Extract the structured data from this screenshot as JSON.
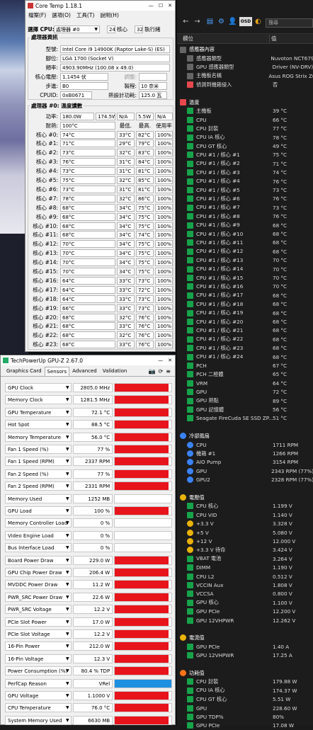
{
  "coretemp": {
    "title": "Core Temp 1.18.1",
    "menu": [
      "檔案(F)",
      "選項(O)",
      "工具(T)",
      "說明(H)"
    ],
    "select_label": "選擇 CPU:",
    "select_value": "處理器 #0",
    "cores": "24",
    "cores_label": "核心",
    "threads": "32",
    "threads_label": "執行緒",
    "info_title": "處理器資訊",
    "model_label": "型號:",
    "model": "Intel Core i9 14900K (Raptor Lake-S)  (ES)",
    "socket_label": "腳位:",
    "socket": "LGA 1700 (Socket V)",
    "freq_label": "頻率:",
    "freq": "4903.90MHz (100.08 x 49.0)",
    "volt_label": "核心電壓:",
    "volt": "1.1454 伏",
    "adj_label": "調整:",
    "step_label": "步進:",
    "step": "B0",
    "proc_label": "製程:",
    "proc": "10 奈米",
    "cpuid_label": "CPUID:",
    "cpuid": "0xB0671",
    "tdp_label": "熱設計功耗:",
    "tdp": "125.0 瓦",
    "temp_title": "處理器 #0: 溫度讀數",
    "power_label": "功率:",
    "power": [
      "180.0W",
      "174.5W",
      "N/A",
      "5.5W",
      "N/A"
    ],
    "tj_label": "耐熱:",
    "tj": "100°C",
    "col_min": "最低.",
    "col_max": "最高.",
    "col_load": "使用率",
    "cores_rows": [
      [
        "核心 #0:",
        "74°C",
        "33°C",
        "82°C",
        "100%"
      ],
      [
        "核心 #1:",
        "71°C",
        "29°C",
        "79°C",
        "100%"
      ],
      [
        "核心 #2:",
        "73°C",
        "32°C",
        "83°C",
        "100%"
      ],
      [
        "核心 #3:",
        "76°C",
        "31°C",
        "84°C",
        "100%"
      ],
      [
        "核心 #4:",
        "73°C",
        "31°C",
        "81°C",
        "100%"
      ],
      [
        "核心 #5:",
        "75°C",
        "32°C",
        "85°C",
        "100%"
      ],
      [
        "核心 #6:",
        "73°C",
        "31°C",
        "81°C",
        "100%"
      ],
      [
        "核心 #7:",
        "78°C",
        "32°C",
        "86°C",
        "100%"
      ],
      [
        "核心 #8:",
        "68°C",
        "34°C",
        "75°C",
        "100%"
      ],
      [
        "核心 #9:",
        "68°C",
        "34°C",
        "75°C",
        "100%"
      ],
      [
        "核心 #10:",
        "68°C",
        "34°C",
        "75°C",
        "100%"
      ],
      [
        "核心 #11:",
        "68°C",
        "34°C",
        "74°C",
        "100%"
      ],
      [
        "核心 #12:",
        "70°C",
        "34°C",
        "75°C",
        "100%"
      ],
      [
        "核心 #13:",
        "70°C",
        "34°C",
        "75°C",
        "100%"
      ],
      [
        "核心 #14:",
        "70°C",
        "34°C",
        "75°C",
        "100%"
      ],
      [
        "核心 #15:",
        "70°C",
        "34°C",
        "75°C",
        "100%"
      ],
      [
        "核心 #16:",
        "64°C",
        "33°C",
        "73°C",
        "100%"
      ],
      [
        "核心 #17:",
        "64°C",
        "33°C",
        "72°C",
        "100%"
      ],
      [
        "核心 #18:",
        "64°C",
        "33°C",
        "73°C",
        "100%"
      ],
      [
        "核心 #19:",
        "66°C",
        "33°C",
        "73°C",
        "100%"
      ],
      [
        "核心 #20:",
        "68°C",
        "32°C",
        "76°C",
        "100%"
      ],
      [
        "核心 #21:",
        "68°C",
        "33°C",
        "76°C",
        "100%"
      ],
      [
        "核心 #22:",
        "68°C",
        "32°C",
        "76°C",
        "100%"
      ],
      [
        "核心 #23:",
        "68°C",
        "33°C",
        "76°C",
        "100%"
      ]
    ]
  },
  "gpuz": {
    "title": "TechPowerUp GPU-Z 2.67.0",
    "tabs": [
      "Graphics Card",
      "Sensors",
      "Advanced",
      "Validation"
    ],
    "active_tab": 1,
    "sensors": [
      {
        "name": "GPU Clock",
        "value": "2805.0 MHz",
        "fill": 0.95
      },
      {
        "name": "Memory Clock",
        "value": "1281.5 MHz",
        "fill": 0.95
      },
      {
        "name": "GPU Temperature",
        "value": "72.1 °C",
        "fill": 0.95
      },
      {
        "name": "Hot Spot",
        "value": "88.5 °C",
        "fill": 0.95
      },
      {
        "name": "Memory Temperature",
        "value": "56.0 °C",
        "fill": 0.95
      },
      {
        "name": "Fan 1 Speed (%)",
        "value": "77 %",
        "fill": 0.95
      },
      {
        "name": "Fan 1 Speed (RPM)",
        "value": "2337 RPM",
        "fill": 0.95
      },
      {
        "name": "Fan 2 Speed (%)",
        "value": "77 %",
        "fill": 0.95
      },
      {
        "name": "Fan 2 Speed (RPM)",
        "value": "2331 RPM",
        "fill": 0.95
      },
      {
        "name": "Memory Used",
        "value": "1252 MB",
        "fill": 0.0
      },
      {
        "name": "GPU Load",
        "value": "100 %",
        "fill": 0.95
      },
      {
        "name": "Memory Controller Load",
        "value": "0 %",
        "fill": 0.0
      },
      {
        "name": "Video Engine Load",
        "value": "0 %",
        "fill": 0.0
      },
      {
        "name": "Bus Interface Load",
        "value": "0 %",
        "fill": 0.0
      },
      {
        "name": "Board Power Draw",
        "value": "229.0 W",
        "fill": 0.95
      },
      {
        "name": "GPU Chip Power Draw",
        "value": "206.4 W",
        "fill": 0.95
      },
      {
        "name": "MVDDC Power Draw",
        "value": "11.2 W",
        "fill": 0.95
      },
      {
        "name": "PWR_SRC Power Draw",
        "value": "22.6 W",
        "fill": 0.95
      },
      {
        "name": "PWR_SRC Voltage",
        "value": "12.2 V",
        "fill": 0.95
      },
      {
        "name": "PCIe Slot Power",
        "value": "17.0 W",
        "fill": 0.95
      },
      {
        "name": "PCIe Slot Voltage",
        "value": "12.2 V",
        "fill": 0.95
      },
      {
        "name": "16-Pin Power",
        "value": "212.0 W",
        "fill": 0.95
      },
      {
        "name": "16-Pin Voltage",
        "value": "12.3 V",
        "fill": 0.95
      },
      {
        "name": "Power Consumption (%)",
        "value": "80.4 % TDP",
        "fill": 0.95
      },
      {
        "name": "PerfCap Reason",
        "value": "VRel",
        "fill": 1.0,
        "color": "#1e90e0"
      },
      {
        "name": "GPU Voltage",
        "value": "1.1000 V",
        "fill": 0.95
      },
      {
        "name": "CPU Temperature",
        "value": "76.0 °C",
        "fill": 0.95
      },
      {
        "name": "System Memory Used",
        "value": "6630 MB",
        "fill": 0.95
      }
    ]
  },
  "hwinfo": {
    "search_placeholder": "搜尋",
    "col_name": "欄位",
    "col_value": "值",
    "rows": [
      {
        "s": true,
        "i": "iw",
        "n": "感應器內容",
        "v": ""
      },
      {
        "i": "iw",
        "n": "感應器類型",
        "v": "Nuvoton NCT679"
      },
      {
        "i": "iw",
        "n": "GPU 感應器類型",
        "v": "Driver  (NV-DRV)"
      },
      {
        "i": "iw",
        "n": "主機板名稱",
        "v": "Asus ROG Strix Z6"
      },
      {
        "i": "ir",
        "n": "偵測到機箱侵入",
        "v": "否"
      },
      {
        "blank": true
      },
      {
        "s": true,
        "i": "ir",
        "n": "溫度",
        "v": ""
      },
      {
        "i": "ig",
        "n": "主機板",
        "v": "39 °C"
      },
      {
        "i": "ig",
        "n": "CPU",
        "v": "66 °C"
      },
      {
        "i": "ig",
        "n": "CPU 封裝",
        "v": "77 °C"
      },
      {
        "i": "ig",
        "n": "CPU IA 核心",
        "v": "78 °C"
      },
      {
        "i": "ig",
        "n": "CPU GT 核心",
        "v": "49 °C"
      },
      {
        "i": "ig",
        "n": "CPU #1 / 核心 #1",
        "v": "75 °C"
      },
      {
        "i": "ig",
        "n": "CPU #1 / 核心 #2",
        "v": "71 °C"
      },
      {
        "i": "ig",
        "n": "CPU #1 / 核心 #3",
        "v": "74 °C"
      },
      {
        "i": "ig",
        "n": "CPU #1 / 核心 #4",
        "v": "76 °C"
      },
      {
        "i": "ig",
        "n": "CPU #1 / 核心 #5",
        "v": "73 °C"
      },
      {
        "i": "ig",
        "n": "CPU #1 / 核心 #6",
        "v": "76 °C"
      },
      {
        "i": "ig",
        "n": "CPU #1 / 核心 #7",
        "v": "73 °C"
      },
      {
        "i": "ig",
        "n": "CPU #1 / 核心 #8",
        "v": "76 °C"
      },
      {
        "i": "ig",
        "n": "CPU #1 / 核心 #9",
        "v": "68 °C"
      },
      {
        "i": "ig",
        "n": "CPU #1 / 核心 #10",
        "v": "68 °C"
      },
      {
        "i": "ig",
        "n": "CPU #1 / 核心 #11",
        "v": "68 °C"
      },
      {
        "i": "ig",
        "n": "CPU #1 / 核心 #12",
        "v": "68 °C"
      },
      {
        "i": "ig",
        "n": "CPU #1 / 核心 #13",
        "v": "70 °C"
      },
      {
        "i": "ig",
        "n": "CPU #1 / 核心 #14",
        "v": "70 °C"
      },
      {
        "i": "ig",
        "n": "CPU #1 / 核心 #15",
        "v": "70 °C"
      },
      {
        "i": "ig",
        "n": "CPU #1 / 核心 #16",
        "v": "70 °C"
      },
      {
        "i": "ig",
        "n": "CPU #1 / 核心 #17",
        "v": "68 °C"
      },
      {
        "i": "ig",
        "n": "CPU #1 / 核心 #18",
        "v": "68 °C"
      },
      {
        "i": "ig",
        "n": "CPU #1 / 核心 #19",
        "v": "68 °C"
      },
      {
        "i": "ig",
        "n": "CPU #1 / 核心 #20",
        "v": "68 °C"
      },
      {
        "i": "ig",
        "n": "CPU #1 / 核心 #21",
        "v": "68 °C"
      },
      {
        "i": "ig",
        "n": "CPU #1 / 核心 #22",
        "v": "68 °C"
      },
      {
        "i": "ig",
        "n": "CPU #1 / 核心 #23",
        "v": "68 °C"
      },
      {
        "i": "ig",
        "n": "CPU #1 / 核心 #24",
        "v": "68 °C"
      },
      {
        "i": "ig",
        "n": "PCH",
        "v": "67 °C"
      },
      {
        "i": "ig",
        "n": "PCH 二極體",
        "v": "65 °C"
      },
      {
        "i": "ig",
        "n": "VRM",
        "v": "64 °C"
      },
      {
        "i": "ig",
        "n": "GPU",
        "v": "72 °C"
      },
      {
        "i": "ig",
        "n": "GPU 熱點",
        "v": "89 °C"
      },
      {
        "i": "ig",
        "n": "GPU 記憶體",
        "v": "56 °C"
      },
      {
        "i": "ig",
        "n": "Seagate FireCuda SE SSD ZP...",
        "v": "51 °C"
      },
      {
        "blank": true
      },
      {
        "s": true,
        "i": "ib",
        "n": "冷卻風扇",
        "v": ""
      },
      {
        "i": "ib",
        "n": "CPU",
        "v": "1711 RPM"
      },
      {
        "i": "ib",
        "n": "機箱 #1",
        "v": "1266 RPM"
      },
      {
        "i": "ib",
        "n": "AIO Pump",
        "v": "3154 RPM"
      },
      {
        "i": "ib",
        "n": "GPU",
        "v": "2343 RPM  (77%)"
      },
      {
        "i": "ib",
        "n": "GPU2",
        "v": "2328 RPM  (77%)"
      },
      {
        "blank": true
      },
      {
        "s": true,
        "i": "iy",
        "n": "電壓值",
        "v": ""
      },
      {
        "i": "ig",
        "n": "CPU 核心",
        "v": "1.199 V"
      },
      {
        "i": "ig",
        "n": "CPU VID",
        "v": "1.140 V"
      },
      {
        "i": "iy",
        "n": "+3.3 V",
        "v": "3.328 V"
      },
      {
        "i": "iy",
        "n": "+5 V",
        "v": "5.080 V"
      },
      {
        "i": "iy",
        "n": "+12 V",
        "v": "12.000 V"
      },
      {
        "i": "iy",
        "n": "+3.3 V 待命",
        "v": "3.424 V"
      },
      {
        "i": "ig",
        "n": "VBAT 電池",
        "v": "3.264 V"
      },
      {
        "i": "ig",
        "n": "DIMM",
        "v": "1.190 V"
      },
      {
        "i": "ig",
        "n": "CPU L2",
        "v": "0.512 V"
      },
      {
        "i": "ig",
        "n": "VCCIN Aux",
        "v": "1.808 V"
      },
      {
        "i": "ig",
        "n": "VCCSA",
        "v": "0.800 V"
      },
      {
        "i": "ig",
        "n": "GPU 核心",
        "v": "1.100 V"
      },
      {
        "i": "ig",
        "n": "GPU PCIe",
        "v": "12.200 V"
      },
      {
        "i": "ig",
        "n": "GPU 12VHPWR",
        "v": "12.262 V"
      },
      {
        "blank": true
      },
      {
        "s": true,
        "i": "iy",
        "n": "電流值",
        "v": ""
      },
      {
        "i": "ig",
        "n": "GPU PCIe",
        "v": "1.40 A"
      },
      {
        "i": "ig",
        "n": "GPU 12VHPWR",
        "v": "17.25 A"
      },
      {
        "blank": true
      },
      {
        "s": true,
        "i": "io",
        "n": "功耗值",
        "v": ""
      },
      {
        "i": "ig",
        "n": "CPU 封裝",
        "v": "179.88 W"
      },
      {
        "i": "ig",
        "n": "CPU IA 核心",
        "v": "174.37 W"
      },
      {
        "i": "ig",
        "n": "CPU GT 核心",
        "v": "5.51 W"
      },
      {
        "i": "ig",
        "n": "GPU",
        "v": "228.60 W"
      },
      {
        "i": "ig",
        "n": "GPU TDP%",
        "v": "80%"
      },
      {
        "i": "ig",
        "n": "GPU PCIe",
        "v": "17.08 W"
      }
    ]
  }
}
